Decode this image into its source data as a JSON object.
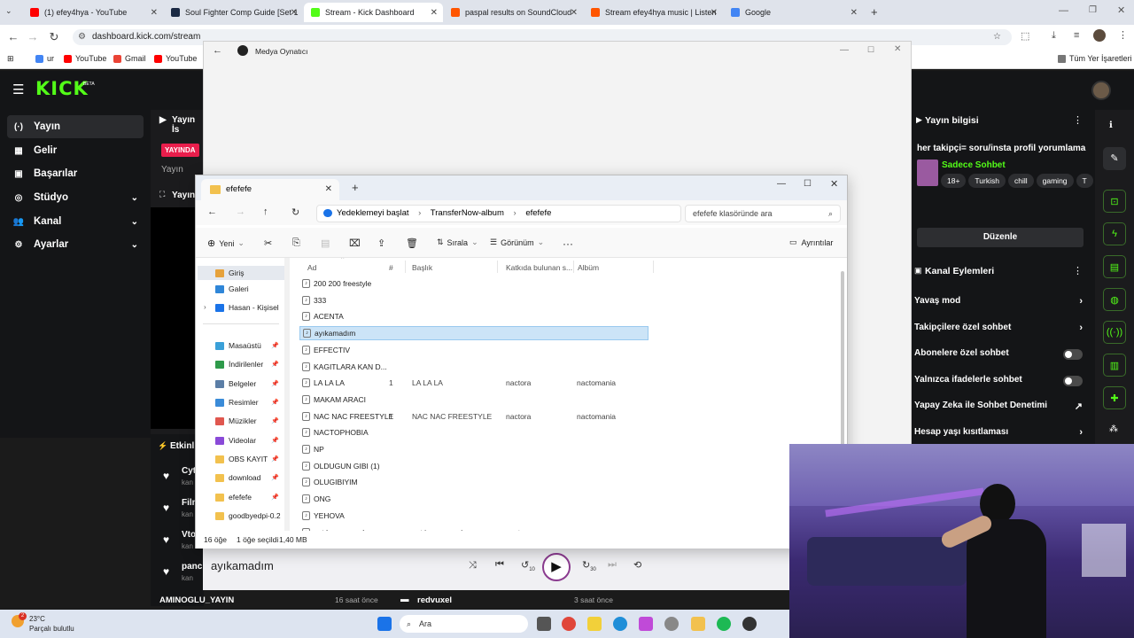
{
  "browser": {
    "tabs": [
      {
        "title": "(1) efey4hya - YouTube",
        "color": "#ff0000"
      },
      {
        "title": "Soul Fighter Comp Guide [Set 1",
        "color": "#1b2a44"
      },
      {
        "title": "Stream - Kick Dashboard",
        "color": "#53fc18"
      },
      {
        "title": "paspal results on SoundCloud",
        "color": "#ff5500"
      },
      {
        "title": "Stream efey4hya music | Listen",
        "color": "#ff5500"
      },
      {
        "title": "Google",
        "color": "#4285f4"
      }
    ],
    "url": "dashboard.kick.com/stream",
    "bookmarks": [
      "ur",
      "YouTube",
      "Gmail",
      "YouTube"
    ],
    "bookmarks_right": "Tüm Yer İşaretleri"
  },
  "kick": {
    "logo": "KICK",
    "beta": "BETA",
    "nav": [
      {
        "label": "Yayın",
        "icon": "(·)",
        "chevron": false
      },
      {
        "label": "Gelir",
        "icon": "▦",
        "chevron": false
      },
      {
        "label": "Başarılar",
        "icon": "▣",
        "chevron": false
      },
      {
        "label": "Stüdyo",
        "icon": "◎",
        "chevron": true
      },
      {
        "label": "Kanal",
        "icon": "👥",
        "chevron": true
      },
      {
        "label": "Ayarlar",
        "icon": "⚙",
        "chevron": true
      }
    ],
    "center": {
      "yayin_is": "Yayın İs",
      "live_badge": "YAYINDA",
      "yayin": "Yayın",
      "yayin2": "Yayın",
      "etkinlik": "Etkinl",
      "events": [
        {
          "name": "Cyt",
          "sub": "kan"
        },
        {
          "name": "Filn",
          "sub": "kan"
        },
        {
          "name": "Vto",
          "sub": "kan"
        },
        {
          "name": "panc",
          "sub": "kan"
        }
      ],
      "bottom_left": "AMINOGLU_YAYIN",
      "bottom_time": "16 saat önce",
      "bottom_user": "redvuxel",
      "bottom_time2": "3 saat önce"
    },
    "right": {
      "title": "Yayın bilgisi",
      "stream_title": "her takipçi= soru/insta profil yorumlama",
      "category": "Sadece Sohbet",
      "tags": [
        "18+",
        "Turkish",
        "chill",
        "gaming",
        "T"
      ],
      "edit": "Düzenle",
      "channel_actions": "Kanal Eylemleri",
      "rows": [
        {
          "label": "Yavaş mod",
          "type": "chevron"
        },
        {
          "label": "Takipçilere özel sohbet",
          "type": "chevron"
        },
        {
          "label": "Abonelere özel sohbet",
          "type": "toggle"
        },
        {
          "label": "Yalnızca ifadelerle sohbet",
          "type": "toggle"
        },
        {
          "label": "Yapay Zeka ile Sohbet Denetimi",
          "type": "external"
        },
        {
          "label": "Hesap yaşı kısıtlaması",
          "type": "chevron"
        }
      ]
    }
  },
  "media": {
    "title": "Medya Oynatıcı",
    "now_playing": "ayıkamadım",
    "skip_back": "10",
    "skip_fwd": "30"
  },
  "explorer": {
    "tab": "efefefe",
    "crumbs": [
      "Yedeklemeyi başlat",
      "TransferNow-album",
      "efefefe"
    ],
    "search_placeholder": "efefefe klasöründe ara",
    "cmd_new": "Yeni",
    "cmd_sort": "Sırala",
    "cmd_view": "Görünüm",
    "cmd_details": "Ayrıntılar",
    "nav": [
      {
        "label": "Giriş",
        "color": "#e6a23c",
        "pinned": false
      },
      {
        "label": "Galeri",
        "color": "#2f86d8",
        "pinned": false
      },
      {
        "label": "Hasan - Kişisel",
        "color": "#1a73e8",
        "pinned": false
      },
      {
        "label": "Masaüstü",
        "color": "#3aa0d8",
        "pinned": true
      },
      {
        "label": "İndirilenler",
        "color": "#2e9a4a",
        "pinned": true
      },
      {
        "label": "Belgeler",
        "color": "#5b7ea6",
        "pinned": true
      },
      {
        "label": "Resimler",
        "color": "#3a8bd8",
        "pinned": true
      },
      {
        "label": "Müzikler",
        "color": "#e0574f",
        "pinned": true
      },
      {
        "label": "Videolar",
        "color": "#8a4ad8",
        "pinned": true
      },
      {
        "label": "OBS KAYIT",
        "color": "#f2c14e",
        "pinned": true
      },
      {
        "label": "download",
        "color": "#f2c14e",
        "pinned": true
      },
      {
        "label": "efefefe",
        "color": "#f2c14e",
        "pinned": true
      },
      {
        "label": "goodbyedpi-0.2",
        "color": "#f2c14e",
        "pinned": false
      }
    ],
    "columns": [
      "Ad",
      "#",
      "Başlık",
      "Katkıda bulunan s...",
      "Albüm"
    ],
    "files": [
      {
        "name": "200 200 freestyle",
        "num": "",
        "title": "",
        "artist": "",
        "album": ""
      },
      {
        "name": "333",
        "num": "",
        "title": "",
        "artist": "",
        "album": ""
      },
      {
        "name": "ACENTA",
        "num": "",
        "title": "",
        "artist": "",
        "album": ""
      },
      {
        "name": "ayıkamadım",
        "num": "",
        "title": "",
        "artist": "",
        "album": "",
        "selected": true
      },
      {
        "name": "EFFECTIV",
        "num": "",
        "title": "",
        "artist": "",
        "album": ""
      },
      {
        "name": "KAGITLARA KAN D...",
        "num": "",
        "title": "",
        "artist": "",
        "album": ""
      },
      {
        "name": "LA LA LA",
        "num": "1",
        "title": "LA LA LA",
        "artist": "nactora",
        "album": "nactomania"
      },
      {
        "name": "MAKAM ARACI",
        "num": "",
        "title": "",
        "artist": "",
        "album": ""
      },
      {
        "name": "NAC NAC FREESTYLE",
        "num": "1",
        "title": "NAC NAC FREESTYLE",
        "artist": "nactora",
        "album": "nactomania"
      },
      {
        "name": "NACTOPHOBIA",
        "num": "",
        "title": "",
        "artist": "",
        "album": ""
      },
      {
        "name": "NP",
        "num": "",
        "title": "",
        "artist": "",
        "album": ""
      },
      {
        "name": "OLDUGUN GIBI (1)",
        "num": "",
        "title": "",
        "artist": "",
        "album": ""
      },
      {
        "name": "OLUGIBIYIM",
        "num": "",
        "title": "",
        "artist": "",
        "album": ""
      },
      {
        "name": "ONG",
        "num": "",
        "title": "",
        "artist": "",
        "album": ""
      },
      {
        "name": "YEHOVA",
        "num": "",
        "title": "",
        "artist": "",
        "album": ""
      },
      {
        "name": "yırtılmış panuclar",
        "num": "",
        "title": "yırtılmış panuclar",
        "artist": "nacto",
        "album": ""
      }
    ],
    "status_count": "16 öğe",
    "status_selected": "1 öğe seçildi",
    "status_size": "1,40 MB"
  },
  "taskbar": {
    "temp": "23°C",
    "weather": "Parçalı bulutlu",
    "search": "Ara",
    "badge": "2"
  }
}
